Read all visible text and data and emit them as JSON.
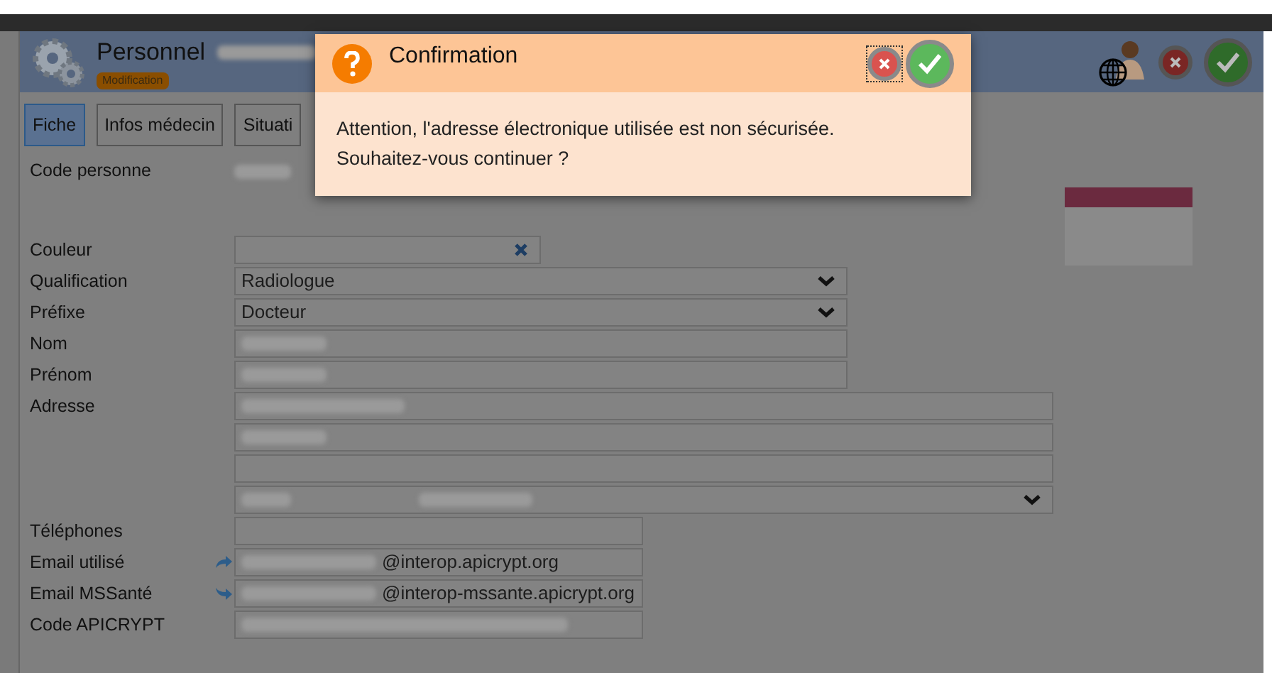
{
  "window": {
    "title": "Personnel",
    "badge": "Modification"
  },
  "tabs": [
    {
      "label": "Fiche",
      "selected": true
    },
    {
      "label": "Infos médecin",
      "selected": false
    },
    {
      "label": "Situati",
      "selected": false
    }
  ],
  "form": {
    "rows": [
      {
        "label": "Code personne",
        "kind": "code",
        "redacted": true
      },
      {
        "label": "Couleur",
        "kind": "color"
      },
      {
        "label": "Qualification",
        "kind": "select",
        "value": "Radiologue"
      },
      {
        "label": "Préfixe",
        "kind": "select",
        "value": "Docteur"
      },
      {
        "label": "Nom",
        "kind": "text",
        "redacted": true
      },
      {
        "label": "Prénom",
        "kind": "text",
        "redacted": true
      },
      {
        "label": "Adresse",
        "kind": "address",
        "redacted": true
      },
      {
        "kind": "address",
        "redacted": true
      },
      {
        "kind": "address",
        "redacted": false
      },
      {
        "kind": "city",
        "redacted": true
      },
      {
        "label": "Téléphones",
        "kind": "contact",
        "redacted": false
      },
      {
        "label": "Email utilisé",
        "kind": "email",
        "redacted": true,
        "suffix": "@interop.apicrypt.org",
        "reply": false
      },
      {
        "label": "Email MSSanté",
        "kind": "email",
        "redacted": true,
        "suffix": "@interop-mssante.apicrypt.org",
        "reply": true
      },
      {
        "label": "Code APICRYPT",
        "kind": "contact",
        "redacted": true
      }
    ]
  },
  "dialog": {
    "title": "Confirmation",
    "message": [
      "Attention, l'adresse électronique utilisée est non sécurisée.",
      "Souhaitez-vous continuer ?"
    ]
  }
}
